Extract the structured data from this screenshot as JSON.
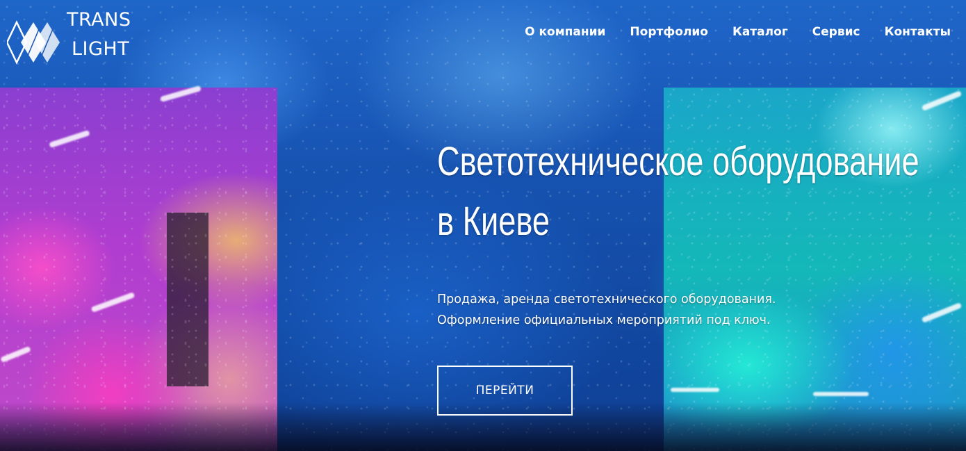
{
  "brand": {
    "line1": "TRANS",
    "line2": "LIGHT",
    "logo_icon": "diamond-logo-icon"
  },
  "nav": {
    "items": [
      {
        "label": "О компании"
      },
      {
        "label": "Портфолио"
      },
      {
        "label": "Каталог"
      },
      {
        "label": "Сервис"
      },
      {
        "label": "Контакты"
      }
    ]
  },
  "hero": {
    "title_line1": "Светотехническое оборудование",
    "title_line2": "в Киеве",
    "subtitle_line1": "Продажа, аренда светотехнического оборудования.",
    "subtitle_line2": "Оформление официальных мероприятий под ключ.",
    "cta_label": "ПЕРЕЙТИ"
  },
  "colors": {
    "text": "#ffffff",
    "background_blue": "#1652b0",
    "left_panel_magenta": "#b13dd0",
    "right_panel_teal": "#14b8b8"
  }
}
